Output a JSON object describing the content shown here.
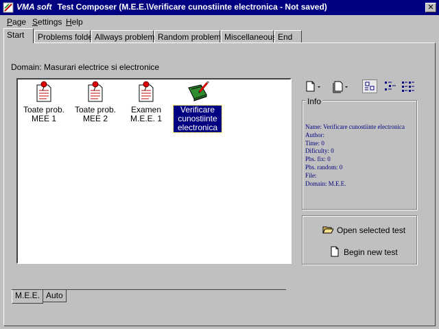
{
  "window": {
    "brand": "VMA soft",
    "title": "Test Composer (M.E.E.\\Verificare cunostiinte electronica - Not saved)",
    "close_glyph": "✕"
  },
  "menu": [
    {
      "label": "Page"
    },
    {
      "label": "Settings"
    },
    {
      "label": "Help"
    }
  ],
  "tabs": [
    {
      "label": "Start",
      "active": true
    },
    {
      "label": "Problems folder"
    },
    {
      "label": "Allways problems"
    },
    {
      "label": "Random problems"
    },
    {
      "label": "Miscellaneous"
    },
    {
      "label": "End"
    }
  ],
  "domain_label": "Domain: Masurari electrice si electronice",
  "tests": [
    {
      "label": "Toate prob. MEE 1",
      "icon": "document-pin-icon"
    },
    {
      "label": "Toate prob. MEE 2",
      "icon": "document-pin-icon"
    },
    {
      "label": "Examen M.E.E. 1",
      "icon": "document-pin-icon"
    },
    {
      "label": "Verificare cunostiinte electronica",
      "icon": "notebook-pencil-icon",
      "selected": true
    }
  ],
  "info": {
    "title": "Info",
    "lines": [
      "Name: Verificare cunostiinte electronica",
      "Author:",
      "Time: 0",
      "Dificulty: 0",
      "Pbs. fix: 0",
      "Pbs. random: 0",
      "File:",
      "Domain: M.E.E."
    ]
  },
  "actions": {
    "open_label": "Open selected test",
    "begin_label": "Begin new test"
  },
  "bottom_tabs": [
    {
      "label": "M.E.E.",
      "active": true
    },
    {
      "label": "Auto"
    }
  ]
}
